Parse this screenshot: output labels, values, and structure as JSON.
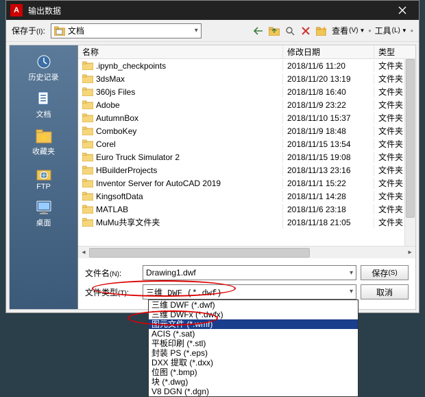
{
  "titlebar": {
    "title": "输出数据",
    "logo_text": "A"
  },
  "toolbar": {
    "save_in_label": "保存于",
    "save_in_suffix": "(I)",
    "save_in_colon": ":",
    "location": "文档",
    "view_label": "查看",
    "view_suffix": "(V)",
    "tools_label": "工具",
    "tools_suffix": "(L)"
  },
  "sidebar": [
    {
      "key": "history",
      "label": "历史记录"
    },
    {
      "key": "documents",
      "label": "文档"
    },
    {
      "key": "favorites",
      "label": "收藏夹"
    },
    {
      "key": "ftp",
      "label": "FTP"
    },
    {
      "key": "desktop",
      "label": "桌面"
    }
  ],
  "columns": {
    "name": "名称",
    "date": "修改日期",
    "type": "类型"
  },
  "rows": [
    {
      "name": ".ipynb_checkpoints",
      "date": "2018/11/6 11:20",
      "type": "文件夹"
    },
    {
      "name": "3dsMax",
      "date": "2018/11/20 13:19",
      "type": "文件夹"
    },
    {
      "name": "360js Files",
      "date": "2018/11/8 16:40",
      "type": "文件夹"
    },
    {
      "name": "Adobe",
      "date": "2018/11/9 23:22",
      "type": "文件夹"
    },
    {
      "name": "AutumnBox",
      "date": "2018/11/10 15:37",
      "type": "文件夹"
    },
    {
      "name": "ComboKey",
      "date": "2018/11/9 18:48",
      "type": "文件夹"
    },
    {
      "name": "Corel",
      "date": "2018/11/15 13:54",
      "type": "文件夹"
    },
    {
      "name": "Euro Truck Simulator 2",
      "date": "2018/11/15 19:08",
      "type": "文件夹"
    },
    {
      "name": "HBuilderProjects",
      "date": "2018/11/13 23:16",
      "type": "文件夹"
    },
    {
      "name": "Inventor Server for AutoCAD 2019",
      "date": "2018/11/1 15:22",
      "type": "文件夹"
    },
    {
      "name": "KingsoftData",
      "date": "2018/11/1 14:28",
      "type": "文件夹"
    },
    {
      "name": "MATLAB",
      "date": "2018/11/6 23:18",
      "type": "文件夹"
    },
    {
      "name": "MuMu共享文件夹",
      "date": "2018/11/18 21:05",
      "type": "文件夹"
    }
  ],
  "filename": {
    "label": "文件名",
    "suffix": "(N)",
    "colon": ":",
    "value": "Drawing1.dwf"
  },
  "filetype": {
    "label": "文件类型",
    "suffix": "(T)",
    "colon": ":",
    "selected": "三维 DWF (*.dwf)",
    "options": [
      "三维 DWF (*.dwf)",
      "三维 DWFx (*.dwfx)",
      "图元文件 (*.wmf)",
      "ACIS (*.sat)",
      "平板印刷 (*.stl)",
      "封装 PS (*.eps)",
      "DXX 提取 (*.dxx)",
      "位图 (*.bmp)",
      "块 (*.dwg)",
      "V8 DGN (*.dgn)"
    ],
    "selected_index": 2
  },
  "buttons": {
    "save": "保存",
    "save_suffix": "(S)",
    "cancel": "取消"
  }
}
